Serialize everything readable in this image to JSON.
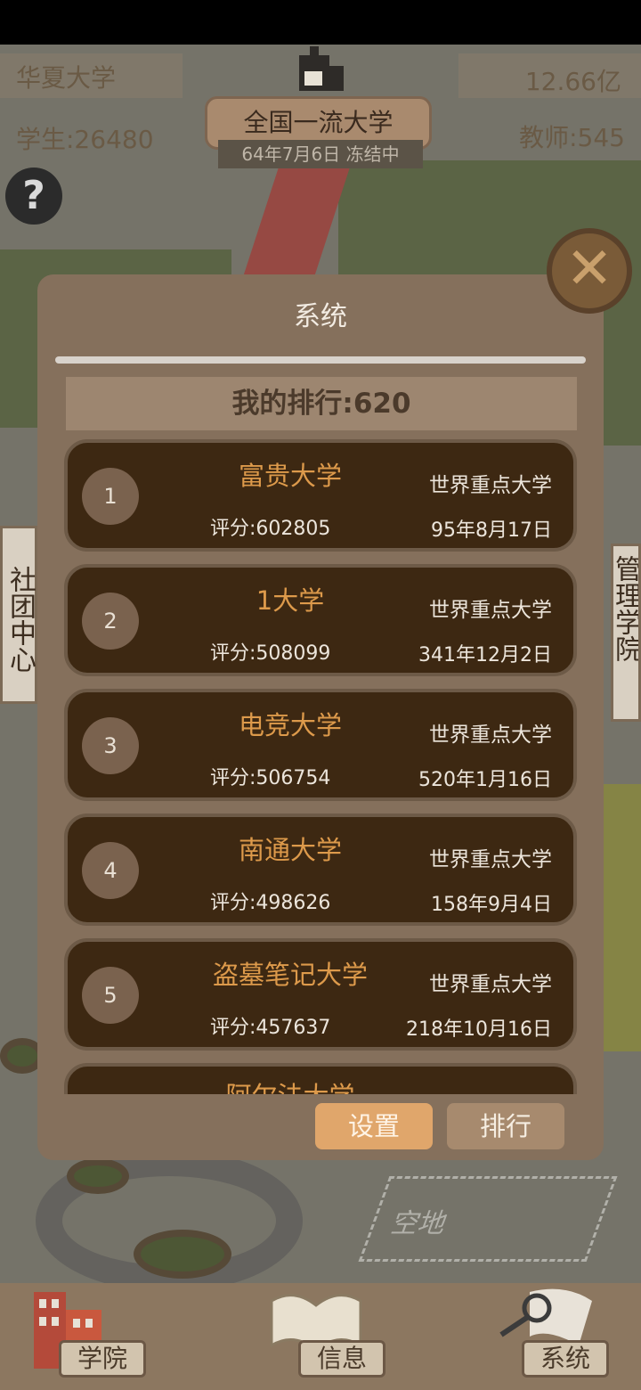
{
  "hud": {
    "school_name": "华夏大学",
    "students": "学生:26480",
    "money": "12.66亿",
    "teachers": "教师:545",
    "tier": "全国一流大学",
    "date": "64年7月6日 冻结中"
  },
  "map_labels": {
    "club_center": "社团中心",
    "side_right": "管理学院",
    "empty_plot": "空地",
    "empty_plot_left": "空地"
  },
  "modal": {
    "title": "系统",
    "my_rank": "我的排行:620",
    "settings_button": "设置",
    "rank_button": "排行",
    "close_icon": "close-icon"
  },
  "rankings": [
    {
      "rank": "1",
      "name": "富贵大学",
      "tier": "世界重点大学",
      "score": "评分:602805",
      "date": "95年8月17日"
    },
    {
      "rank": "2",
      "name": "1大学",
      "tier": "世界重点大学",
      "score": "评分:508099",
      "date": "341年12月2日"
    },
    {
      "rank": "3",
      "name": "电竞大学",
      "tier": "世界重点大学",
      "score": "评分:506754",
      "date": "520年1月16日"
    },
    {
      "rank": "4",
      "name": "南通大学",
      "tier": "世界重点大学",
      "score": "评分:498626",
      "date": "158年9月4日"
    },
    {
      "rank": "5",
      "name": "盗墓笔记大学",
      "tier": "世界重点大学",
      "score": "评分:457637",
      "date": "218年10月16日"
    },
    {
      "rank": "",
      "name": "阿尔法大学",
      "tier": "",
      "score": "",
      "date": ""
    }
  ],
  "nav": {
    "college": "学院",
    "info": "信息",
    "system": "系统"
  },
  "colors": {
    "card_bg": "#3d2812",
    "name_orange": "#dd9a4b",
    "modal_bg": "#85705c",
    "settings_button": "#e0a66b"
  }
}
